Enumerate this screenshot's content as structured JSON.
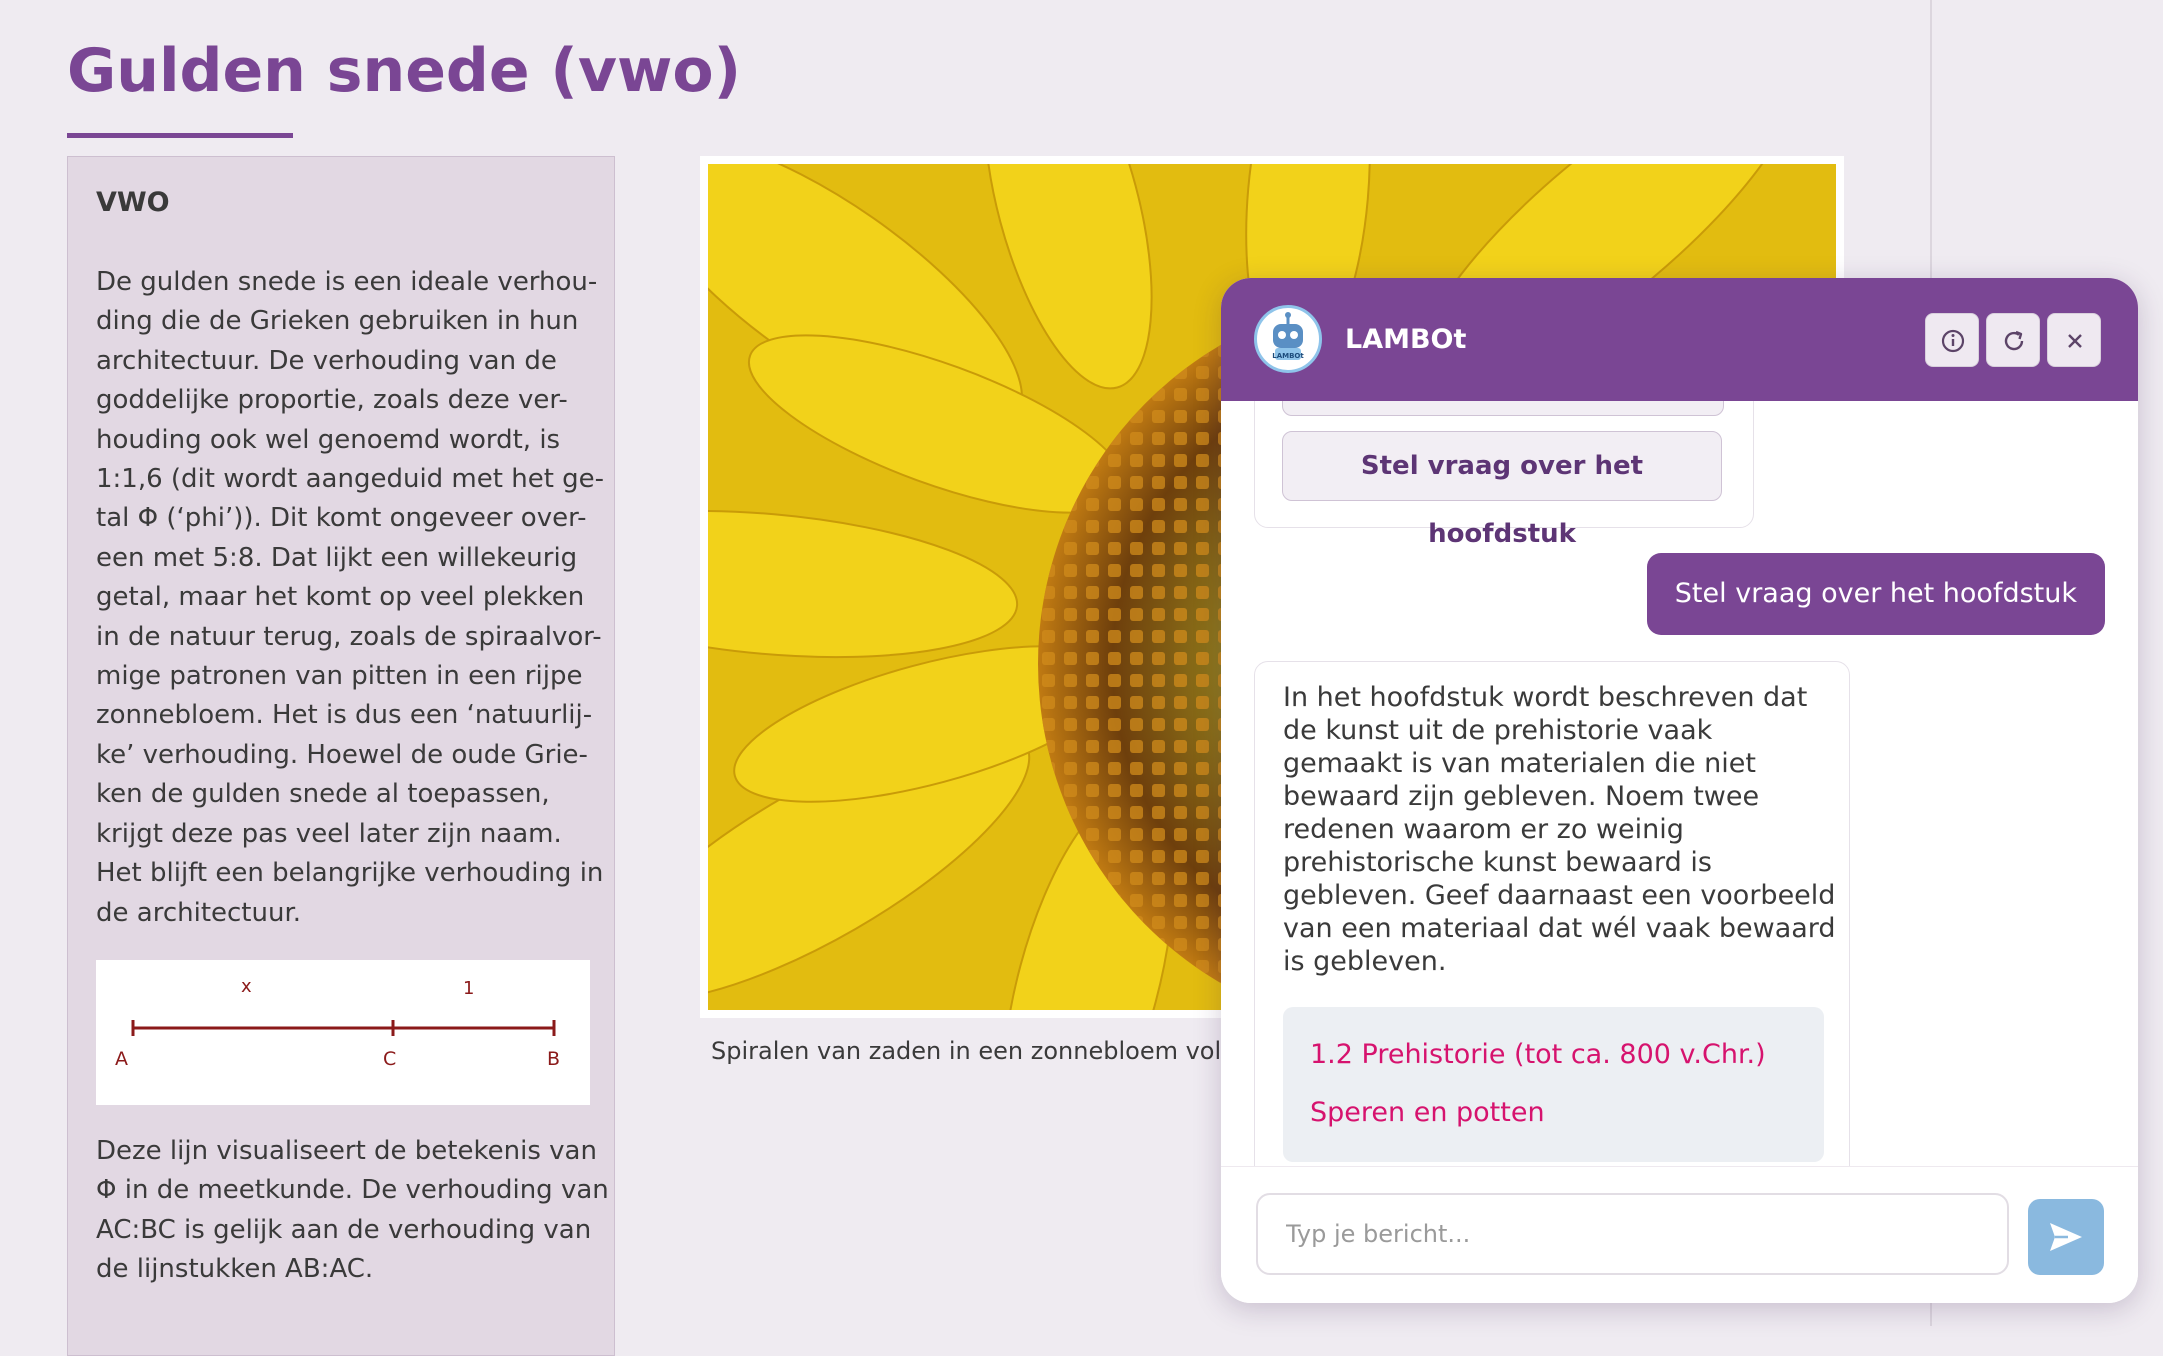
{
  "page": {
    "title": "Gulden snede (vwo)"
  },
  "sidebar": {
    "heading": "VWO",
    "paragraph_lines": [
      "De gulden snede is een ideale verhou-",
      "ding die de Grieken gebruiken in hun",
      "architectuur. De verhouding van de",
      "goddelijke proportie, zoals deze ver-",
      "houding ook wel genoemd wordt, is",
      "1:1,6 (dit wordt aangeduid met het ge-",
      "tal Φ (‘phi’)). Dit komt ongeveer over-",
      "een met 5:8. Dat lijkt een willekeurig",
      "getal, maar het komt op veel plekken",
      "in de natuur terug, zoals de spiraalvor-",
      "mige patronen van pitten in een rijpe",
      "zonnebloem. Het is dus een ‘natuurlij-",
      "ke’ verhouding. Hoewel de oude Grie-",
      "ken de gulden snede al toepassen,",
      "krijgt deze pas veel later zijn naam.",
      "Het blijft een belangrijke verhouding in",
      "de architectuur."
    ],
    "diagram": {
      "label_x": "x",
      "label_1": "1",
      "point_a": "A",
      "point_c": "C",
      "point_b": "B",
      "line_color": "#8b1a1a"
    },
    "paragraph2_lines": [
      "Deze lijn visualiseert de betekenis van",
      "Φ in de meetkunde. De verhouding van",
      "AC:BC is gelijk aan de verhouding van",
      "de lijnstukken AB:AC."
    ]
  },
  "figure": {
    "image_name": "sunflower-photo",
    "caption": "Spiralen van zaden in een zonnebloem volg"
  },
  "chat": {
    "title": "LAMBOt",
    "avatar_icon": "robot-avatar-icon",
    "avatar_text": "LAMBOt",
    "buttons": {
      "info_icon": "info-icon",
      "refresh_icon": "refresh-icon",
      "close_icon": "close-icon"
    },
    "option_chip_label": "Stel vraag over het hoofdstuk",
    "user_message": "Stel vraag over het hoofdstuk",
    "bot_message_lines": [
      "In het hoofdstuk wordt beschreven dat",
      "de kunst uit de prehistorie vaak",
      "gemaakt is van materialen die niet",
      "bewaard zijn gebleven. Noem twee",
      "redenen waarom er zo weinig",
      "prehistorische kunst bewaard is",
      "gebleven. Geef daarnaast een voorbeeld",
      "van een materiaal dat wél vaak bewaard",
      "is gebleven."
    ],
    "sources": [
      "1.2 Prehistorie (tot ca. 800 v.Chr.)",
      "Speren en potten"
    ],
    "input_placeholder": "Typ je bericht...",
    "input_value": "",
    "send_icon": "send-icon"
  },
  "colors": {
    "brand_purple": "#7a4694",
    "link_pink": "#d6136e",
    "send_blue": "#8ab9df",
    "page_bg": "#efebf1"
  }
}
